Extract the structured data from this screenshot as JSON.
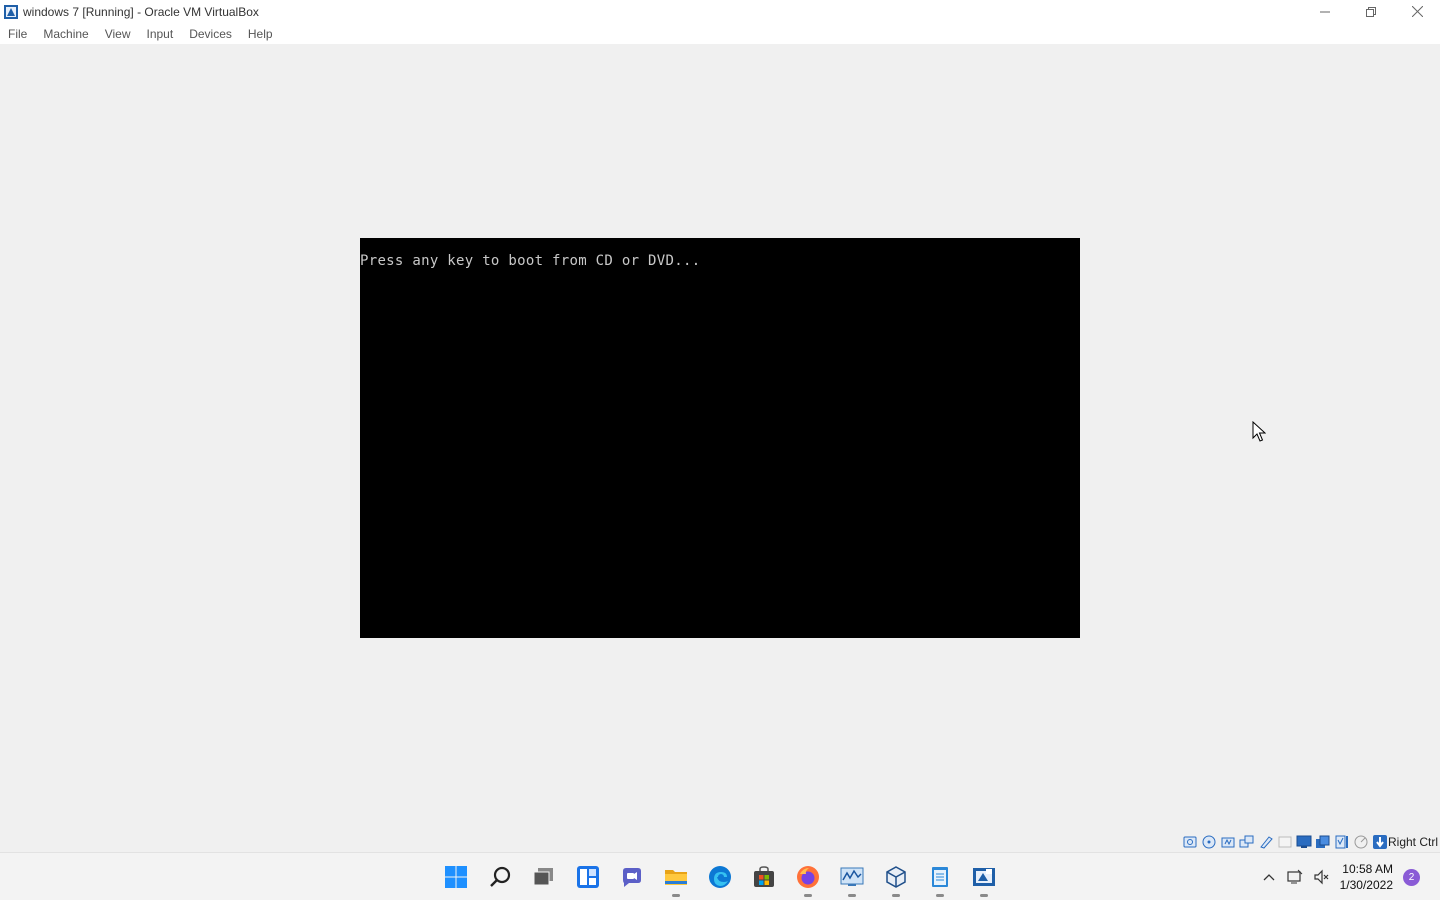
{
  "window": {
    "title": "windows 7 [Running] - Oracle VM VirtualBox",
    "app_icon": "virtualbox-icon",
    "controls": {
      "minimize": "—",
      "restore": "❐",
      "close": "✕"
    }
  },
  "menu": {
    "items": [
      "File",
      "Machine",
      "View",
      "Input",
      "Devices",
      "Help"
    ]
  },
  "vm": {
    "console_text": "Press any key to boot from CD or DVD..."
  },
  "statusbar": {
    "icons": [
      "hard-disk-icon",
      "optical-drive-icon",
      "audio-icon",
      "network-icon",
      "usb-icon",
      "shared-folders-icon",
      "display-icon",
      "video-capture-icon",
      "virtualization-icon",
      "cpu-icon",
      "mouse-integration-icon",
      "host-key-icon"
    ],
    "host_key": "Right Ctrl"
  },
  "taskbar": {
    "apps": [
      {
        "name": "start-button",
        "icon": "windows-logo-icon",
        "running": false
      },
      {
        "name": "search-button",
        "icon": "search-icon",
        "running": false
      },
      {
        "name": "task-view-button",
        "icon": "task-view-icon",
        "running": false
      },
      {
        "name": "widgets-button",
        "icon": "widgets-icon",
        "running": false
      },
      {
        "name": "chat-button",
        "icon": "teams-chat-icon",
        "running": false
      },
      {
        "name": "file-explorer-button",
        "icon": "folder-icon",
        "running": true
      },
      {
        "name": "edge-button",
        "icon": "edge-icon",
        "running": false
      },
      {
        "name": "store-button",
        "icon": "store-icon",
        "running": false
      },
      {
        "name": "firefox-button",
        "icon": "firefox-icon",
        "running": true
      },
      {
        "name": "resource-monitor-button",
        "icon": "monitor-chart-icon",
        "running": true
      },
      {
        "name": "virtualbox-manager-button",
        "icon": "virtualbox-cube-icon",
        "running": true
      },
      {
        "name": "notepad-button",
        "icon": "notepad-icon",
        "running": true
      },
      {
        "name": "virtualbox-vm-button",
        "icon": "virtualbox-vm-icon",
        "running": true
      }
    ],
    "tray": {
      "overflow": "^",
      "time": "10:58 AM",
      "date": "1/30/2022",
      "notifications": "2"
    }
  },
  "colors": {
    "vm_background": "#000000",
    "console_text": "#c8c8c8",
    "window_background": "#f0f0f0",
    "accent": "#0078d4"
  }
}
